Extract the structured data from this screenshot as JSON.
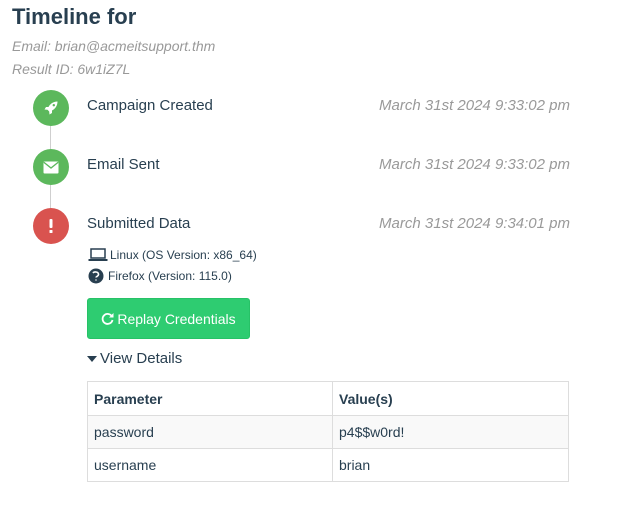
{
  "header": {
    "title": "Timeline for",
    "email": "Email: brian@acmeitsupport.thm",
    "result_id": "Result ID: 6w1iZ7L"
  },
  "timeline": [
    {
      "label": "Campaign Created",
      "time": "March 31st 2024 9:33:02 pm",
      "icon": "rocket-icon",
      "color": "#5cb85c"
    },
    {
      "label": "Email Sent",
      "time": "March 31st 2024 9:33:02 pm",
      "icon": "envelope-icon",
      "color": "#5cb85c"
    },
    {
      "label": "Submitted Data",
      "time": "March 31st 2024 9:34:01 pm",
      "icon": "exclamation-icon",
      "color": "#d9534f"
    }
  ],
  "environment": {
    "os": "Linux (OS Version: x86_64)",
    "browser": "Firefox (Version: 115.0)"
  },
  "replay_button": "Replay Credentials",
  "details_toggle": "View Details",
  "table": {
    "headers": [
      "Parameter",
      "Value(s)"
    ],
    "rows": [
      [
        "password",
        "p4$$w0rd!"
      ],
      [
        "username",
        "brian"
      ]
    ]
  },
  "colors": {
    "success": "#5cb85c",
    "danger": "#d9534f",
    "button": "#2ecc71",
    "text": "#283f50",
    "muted": "#999999"
  }
}
